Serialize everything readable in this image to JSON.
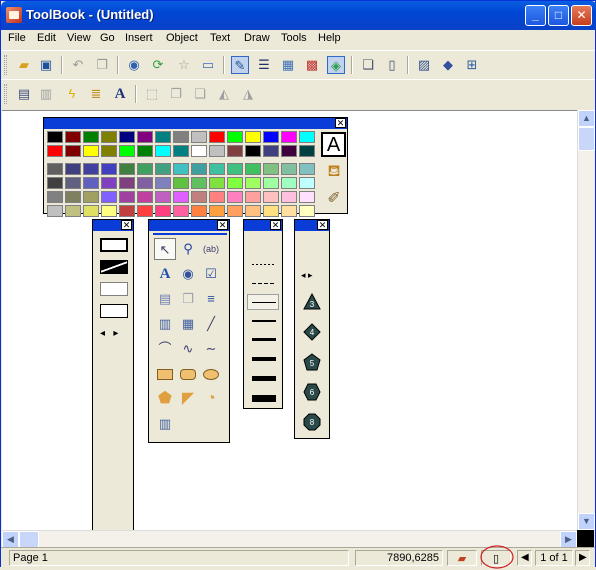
{
  "app": {
    "title": "ToolBook - (Untitled)",
    "window_buttons": {
      "minimize": "_",
      "maximize": "□",
      "close": "✕"
    }
  },
  "menu": [
    "File",
    "Edit",
    "View",
    "Go",
    "Insert",
    "Object",
    "Text",
    "Draw",
    "Tools",
    "Help"
  ],
  "toolbar1_icons": [
    "open-icon",
    "save-icon",
    "undo-icon",
    "redo-icon",
    "find-icon",
    "link-icon",
    "star-icon",
    "card-icon",
    "author-mode-icon",
    "list-icon",
    "image-editor-icon",
    "palette-icon",
    "globe-icon",
    "copy-page-icon",
    "new-page-icon",
    "picture-icon",
    "diamond-icon",
    "layout-icon"
  ],
  "toolbar2_icons": [
    "properties-icon",
    "stack-icon",
    "lightning-icon",
    "script-icon",
    "text-font-icon",
    "align-icon",
    "group-icon",
    "ungroup-icon",
    "flip-horizontal-icon",
    "flip-vertical-icon"
  ],
  "status": {
    "page": "Page 1",
    "coordinates": "7890,6285",
    "page_count": "1 of 1"
  },
  "color_palette": {
    "row1": [
      "#000000",
      "#800000",
      "#008000",
      "#808000",
      "#000080",
      "#800080",
      "#008080",
      "#808080",
      "#c0c0c0",
      "#ff0000",
      "#00ff00",
      "#ffff00",
      "#0000ff",
      "#ff00ff",
      "#00ffff"
    ],
    "row2": [
      "#ff0000",
      "#800000",
      "#ffff00",
      "#808000",
      "#00ff00",
      "#008000",
      "#00ffff",
      "#008080",
      "#ffffff",
      "#c0c0c0",
      "#804040",
      "#000000",
      "#404080",
      "#400040",
      "#004040"
    ],
    "row3": [
      "#606060",
      "#404080",
      "#4040a0",
      "#4040c0",
      "#408040",
      "#40a060",
      "#40a080",
      "#40c0c0",
      "#40a0a0",
      "#40c0a0",
      "#40c080",
      "#40c060",
      "#80c080",
      "#80c0a0",
      "#80c0c0"
    ],
    "row4": [
      "#404040",
      "#606080",
      "#6060c0",
      "#8040c0",
      "#804080",
      "#8060a0",
      "#8080c0",
      "#60c040",
      "#60c060",
      "#80e040",
      "#80ff40",
      "#a0ff60",
      "#a0ffa0",
      "#a0ffc0",
      "#c0ffff"
    ],
    "row5": [
      "#808080",
      "#808060",
      "#a0a060",
      "#8060ff",
      "#a040a0",
      "#c040a0",
      "#c060c0",
      "#e060ff",
      "#c08080",
      "#ff8080",
      "#ff80c0",
      "#ffa0a0",
      "#ffc0c0",
      "#ffc0e0",
      "#ffe0ff"
    ],
    "row6": [
      "#c0c0c0",
      "#c0c080",
      "#e0e060",
      "#ffff80",
      "#c04040",
      "#ff4040",
      "#ff4080",
      "#ff60a0",
      "#ff8040",
      "#ffa040",
      "#ffa060",
      "#ffc080",
      "#ffe080",
      "#ffe0a0",
      "#ffffc0"
    ]
  }
}
